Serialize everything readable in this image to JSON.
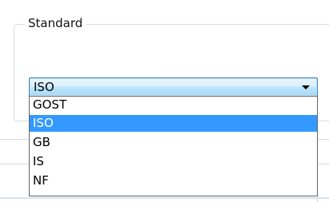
{
  "groupbox": {
    "title": "Standard"
  },
  "combo": {
    "value": "ISO"
  },
  "dropdown": {
    "items": [
      {
        "label": "GOST",
        "selected": false
      },
      {
        "label": "ISO",
        "selected": true
      },
      {
        "label": "GB",
        "selected": false
      },
      {
        "label": "IS",
        "selected": false
      },
      {
        "label": "NF",
        "selected": false
      }
    ]
  },
  "colors": {
    "selection": "#3399ff",
    "combo_border": "#3c7fb1"
  },
  "icons": {
    "combo_arrow": "chevron-down-icon"
  }
}
